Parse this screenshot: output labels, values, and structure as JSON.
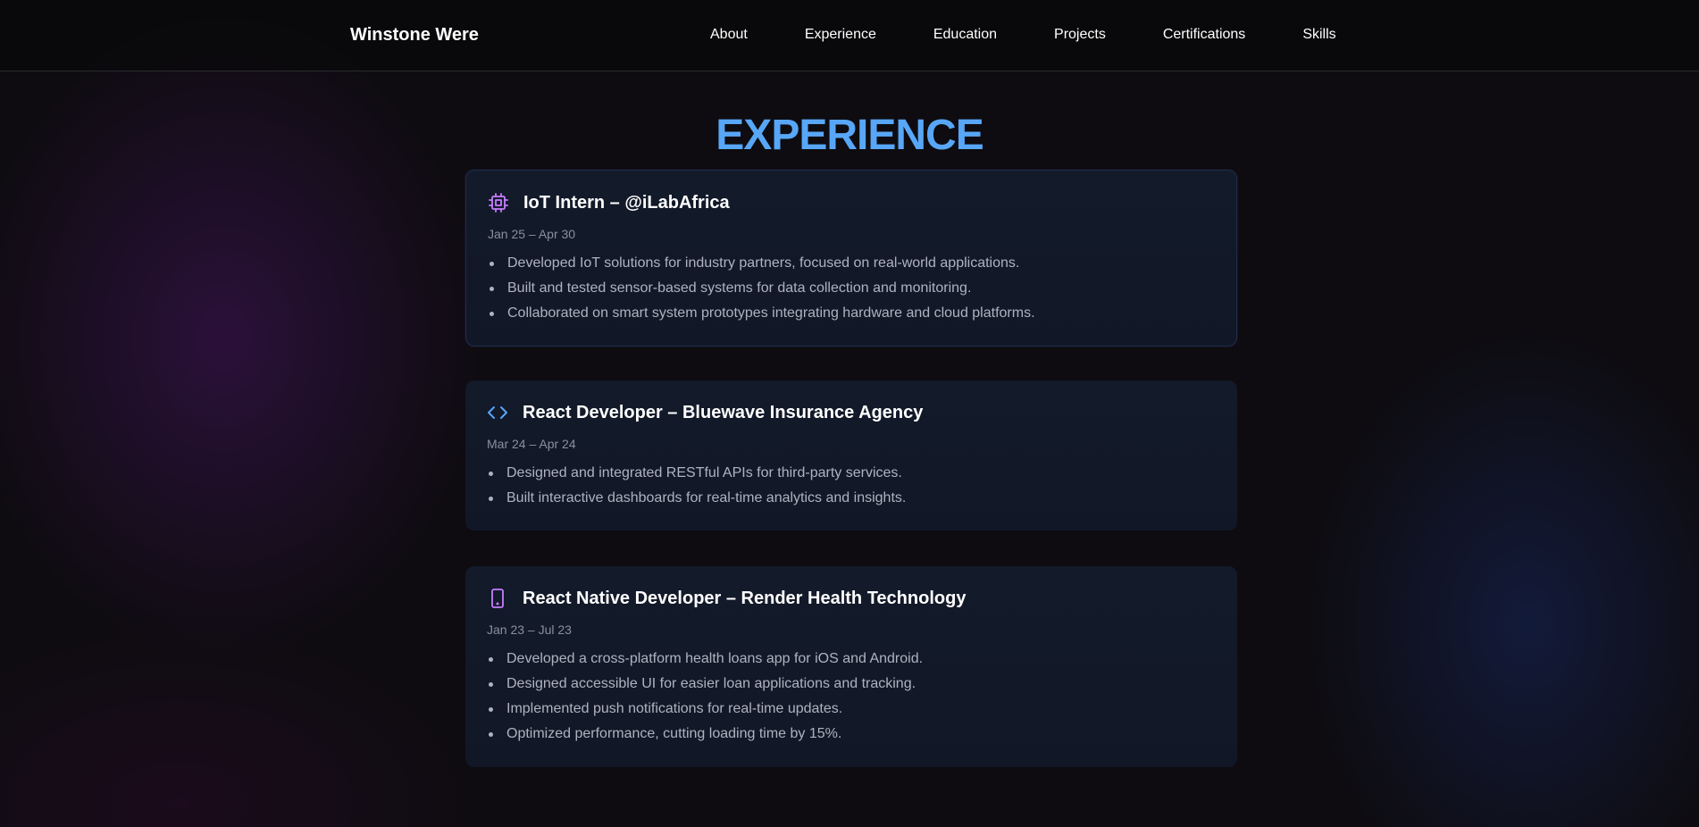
{
  "header": {
    "brand": "Winstone Were",
    "nav": [
      "About",
      "Experience",
      "Education",
      "Projects",
      "Certifications",
      "Skills"
    ]
  },
  "section": {
    "title": "EXPERIENCE"
  },
  "experience": [
    {
      "icon": "chip-icon",
      "icon_color": "#c77dff",
      "title": "IoT Intern – @iLabAfrica",
      "date": "Jan 25 – Apr 30",
      "bullets": [
        "Developed IoT solutions for industry partners, focused on real-world applications.",
        "Built and tested sensor-based systems for data collection and monitoring.",
        "Collaborated on smart system prototypes integrating hardware and cloud platforms."
      ]
    },
    {
      "icon": "code-icon",
      "icon_color": "#58a6f7",
      "title": "React Developer – Bluewave Insurance Agency",
      "date": "Mar 24 – Apr 24",
      "bullets": [
        "Designed and integrated RESTful APIs for third-party services.",
        "Built interactive dashboards for real-time analytics and insights."
      ]
    },
    {
      "icon": "smartphone-icon",
      "icon_color": "#c77dff",
      "title": "React Native Developer – Render Health Technology",
      "date": "Jan 23 – Jul 23",
      "bullets": [
        "Developed a cross-platform health loans app for iOS and Android.",
        "Designed accessible UI for easier loan applications and tracking.",
        "Implemented push notifications for real-time updates.",
        "Optimized performance, cutting loading time by 15%."
      ]
    }
  ]
}
